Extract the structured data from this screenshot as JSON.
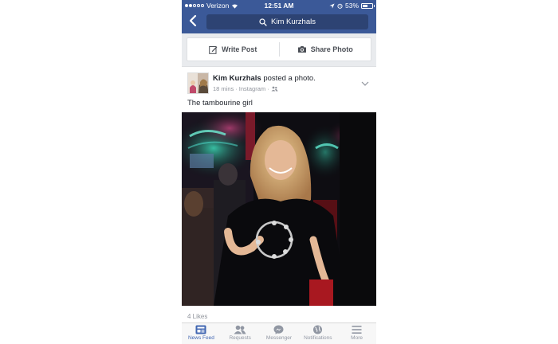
{
  "status_bar": {
    "carrier": "Verizon",
    "time": "12:51 AM",
    "battery": "53%",
    "battery_level": 0.53
  },
  "nav": {
    "search_text": "Kim Kurzhals"
  },
  "composer": {
    "write_post": "Write Post",
    "share_photo": "Share Photo"
  },
  "post": {
    "author": "Kim Kurzhals",
    "action": " posted a photo.",
    "time": "18 mins",
    "source": "Instagram",
    "separator": "·",
    "caption": "The tambourine girl",
    "likes": "4 Likes"
  },
  "tabbar": {
    "items": [
      {
        "label": "News Feed",
        "icon": "news-feed-icon",
        "active": true
      },
      {
        "label": "Requests",
        "icon": "friend-requests-icon",
        "active": false
      },
      {
        "label": "Messenger",
        "icon": "messenger-icon",
        "active": false
      },
      {
        "label": "Notifications",
        "icon": "globe-icon",
        "active": false
      },
      {
        "label": "More",
        "icon": "menu-icon",
        "active": false
      }
    ]
  },
  "colors": {
    "brand": "#3b5998",
    "active_tab": "#4267b2",
    "muted": "#90949c"
  }
}
